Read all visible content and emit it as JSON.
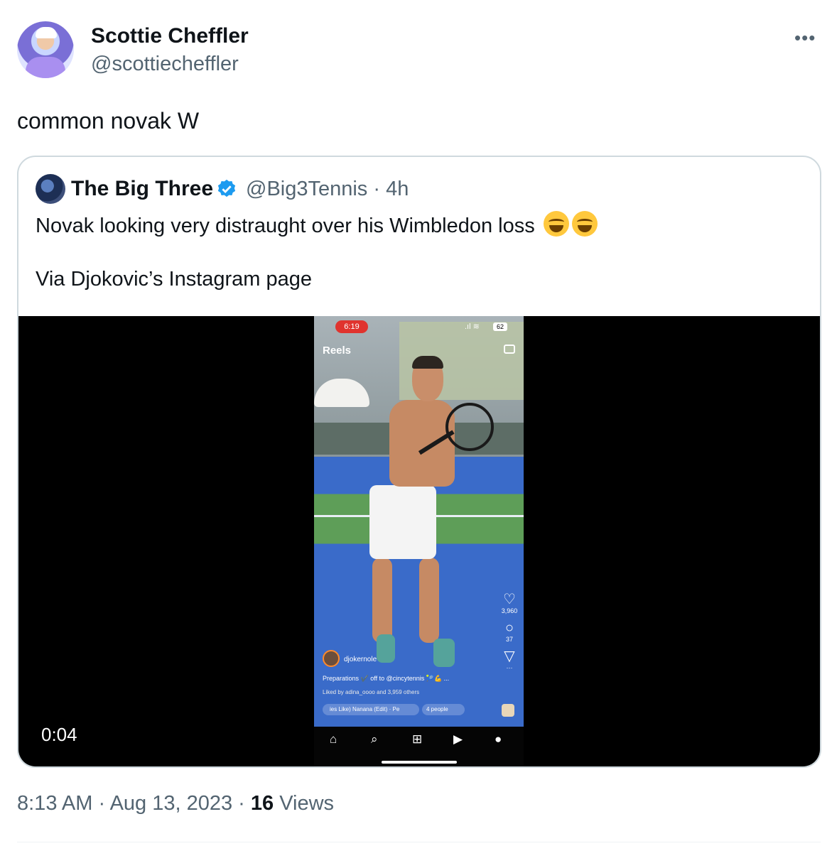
{
  "author": {
    "name": "Scottie Cheffler",
    "handle": "@scottiecheffler",
    "more_icon": "ellipsis-icon"
  },
  "tweet": {
    "text": "common novak W"
  },
  "quoted_tweet": {
    "name": "The Big Three",
    "verified": true,
    "handle_time": "@Big3Tennis · 4h",
    "text_line1": "Novak looking very distraught over his Wimbledon loss",
    "emojis": [
      "face-with-tears-of-joy",
      "face-with-tears-of-joy"
    ],
    "text_line2": "Via Djokovic’s Instagram page",
    "video": {
      "duration_label": "0:04",
      "phone_screen": {
        "status_time": "6:19",
        "battery": "62",
        "header": "Reels",
        "likes": "3,960",
        "comments": "37",
        "username": "djokernole",
        "caption": "Preparations ✔️ off to @cincytennis 🎾💪 ...",
        "liked_by": "Liked by adina_oooo and 3,959 others",
        "audio": "ies Like) Nanana (Edit) · Pe",
        "people": "4 people"
      }
    }
  },
  "footer": {
    "time_date": "8:13 AM · Aug 13, 2023 · ",
    "views_count": "16",
    "views_label": " Views"
  },
  "colors": {
    "text_primary": "#0f1419",
    "text_secondary": "#536471",
    "border": "#cfd9de",
    "verified_blue": "#1d9bf0"
  }
}
